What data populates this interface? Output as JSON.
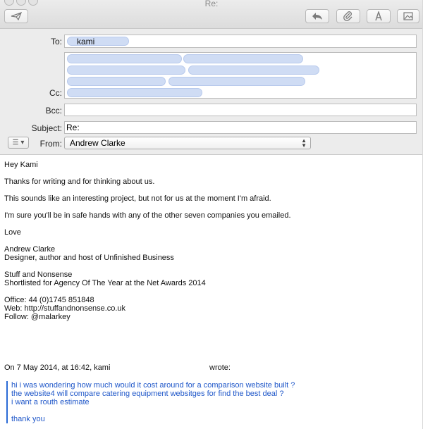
{
  "window": {
    "title": "Re:"
  },
  "toolbar": {
    "send_icon": "paper-plane-icon",
    "reply_icon": "reply-arrow-icon",
    "attach_icon": "paperclip-icon",
    "format_icon": "font-a-icon",
    "photo_icon": "photo-browser-icon"
  },
  "header": {
    "to_label": "To:",
    "to_token": "kami",
    "cc_label": "Cc:",
    "bcc_label": "Bcc:",
    "bcc_value": "",
    "subject_label": "Subject:",
    "subject_value": "Re:",
    "from_label": "From:",
    "from_value": "Andrew Clarke",
    "menu_icon": "list-menu-icon"
  },
  "body": {
    "greeting": "Hey Kami",
    "line1": "Thanks for writing and for thinking about us.",
    "line2": "This sounds like an interesting project, but not for us at the moment I'm afraid.",
    "line3": "I'm sure you'll be in safe hands with any of the other seven companies you emailed.",
    "signoff": "Love",
    "sig_name": "Andrew Clarke",
    "sig_title": "Designer, author and host of Unfinished Business",
    "company": "Stuff and Nonsense",
    "award": "Shortlisted for Agency Of The Year at the Net Awards 2014",
    "office": "Office: 44 (0)1745 851848",
    "web": "Web: http://stuffandnonsense.co.uk",
    "follow": "Follow: @malarkey",
    "quote_attrib_left": "On 7 May 2014, at 16:42, kami",
    "quote_attrib_right": "wrote:"
  },
  "quote": {
    "line1": "hi i was wondering how much would it cost around for a comparison website built ?",
    "line2": "the website4 will compare catering equipment websitges for find the best deal ?",
    "line3": "i want a routh estimate",
    "line4": "thank you"
  }
}
